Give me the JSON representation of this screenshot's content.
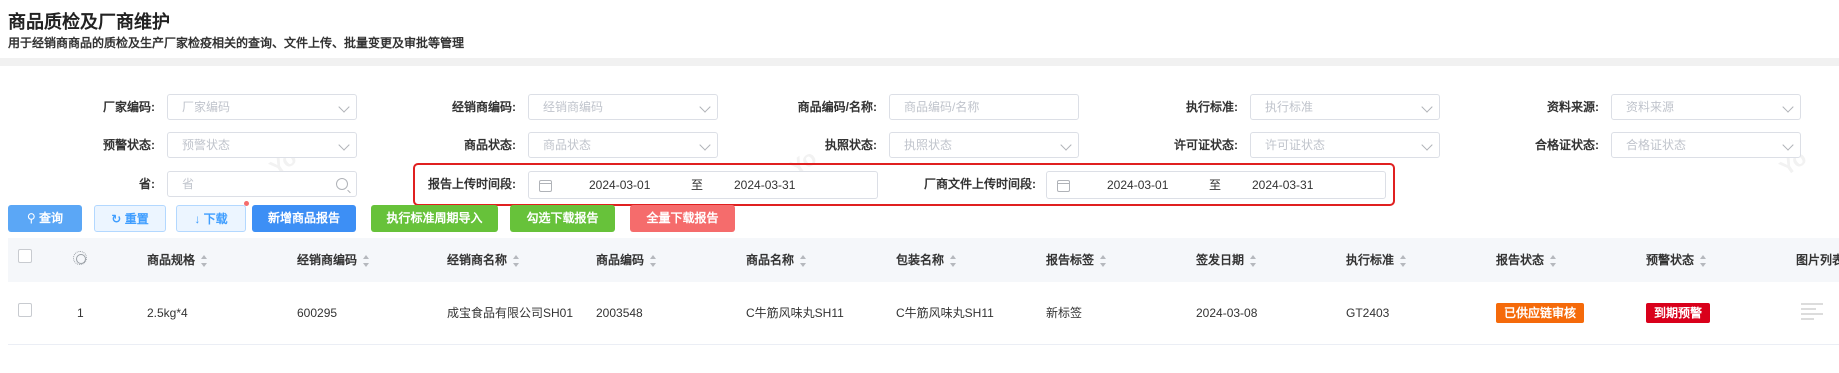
{
  "header": {
    "title": "商品质检及厂商维护",
    "subtitle": "用于经销商商品的质检及生产厂家检疫相关的查询、文件上传、批量变更及审批等管理"
  },
  "filters": {
    "vendor_code": {
      "label": "厂家编码:",
      "placeholder": "厂家编码"
    },
    "dealer_code": {
      "label": "经销商编码:",
      "placeholder": "经销商编码"
    },
    "product_code_name": {
      "label": "商品编码/名称:",
      "placeholder": "商品编码/名称"
    },
    "exec_standard": {
      "label": "执行标准:",
      "placeholder": "执行标准"
    },
    "data_source": {
      "label": "资料来源:",
      "placeholder": "资料来源"
    },
    "warning_status": {
      "label": "预警状态:",
      "placeholder": "预警状态"
    },
    "product_status": {
      "label": "商品状态:",
      "placeholder": "商品状态"
    },
    "license_status": {
      "label": "执照状态:",
      "placeholder": "执照状态"
    },
    "permit_status": {
      "label": "许可证状态:",
      "placeholder": "许可证状态"
    },
    "certificate_status": {
      "label": "合格证状态:",
      "placeholder": "合格证状态"
    },
    "province": {
      "label": "省:",
      "placeholder": "省"
    },
    "report_upload": {
      "label": "报告上传时间段:",
      "start": "2024-03-01",
      "sep": "至",
      "end": "2024-03-31"
    },
    "vendor_file_upload": {
      "label": "厂商文件上传时间段:",
      "start": "2024-03-01",
      "sep": "至",
      "end": "2024-03-31"
    }
  },
  "toolbar": {
    "query": "查询",
    "reset": "重置",
    "download": "下载",
    "add_report": "新增商品报告",
    "import_cycle": "执行标准周期导入",
    "download_selected": "勾选下载报告",
    "download_all": "全量下载报告"
  },
  "colors": {
    "primary": "#409eff",
    "success": "#67c23a",
    "danger": "#f56c6c",
    "highlight_box": "#e02020",
    "tag_orange": "#f56a0a",
    "tag_red": "#d9001b"
  },
  "table": {
    "columns": [
      "商品规格",
      "经销商编码",
      "经销商名称",
      "商品编码",
      "商品名称",
      "包装名称",
      "报告标签",
      "签发日期",
      "执行标准",
      "报告状态",
      "预警状态",
      "图片列表"
    ],
    "rows": [
      {
        "index": "1",
        "spec": "2.5kg*4",
        "dealer_code": "600295",
        "dealer_name": "成宝食品有限公司SH01",
        "product_code": "2003548",
        "product_name": "C牛筋风味丸SH11",
        "package_name": "C牛筋风味丸SH11",
        "report_tag": "新标签",
        "issue_date": "2024-03-08",
        "exec_standard": "GT2403",
        "report_status": "已供应链审核",
        "warning_status": "到期预警"
      }
    ]
  }
}
